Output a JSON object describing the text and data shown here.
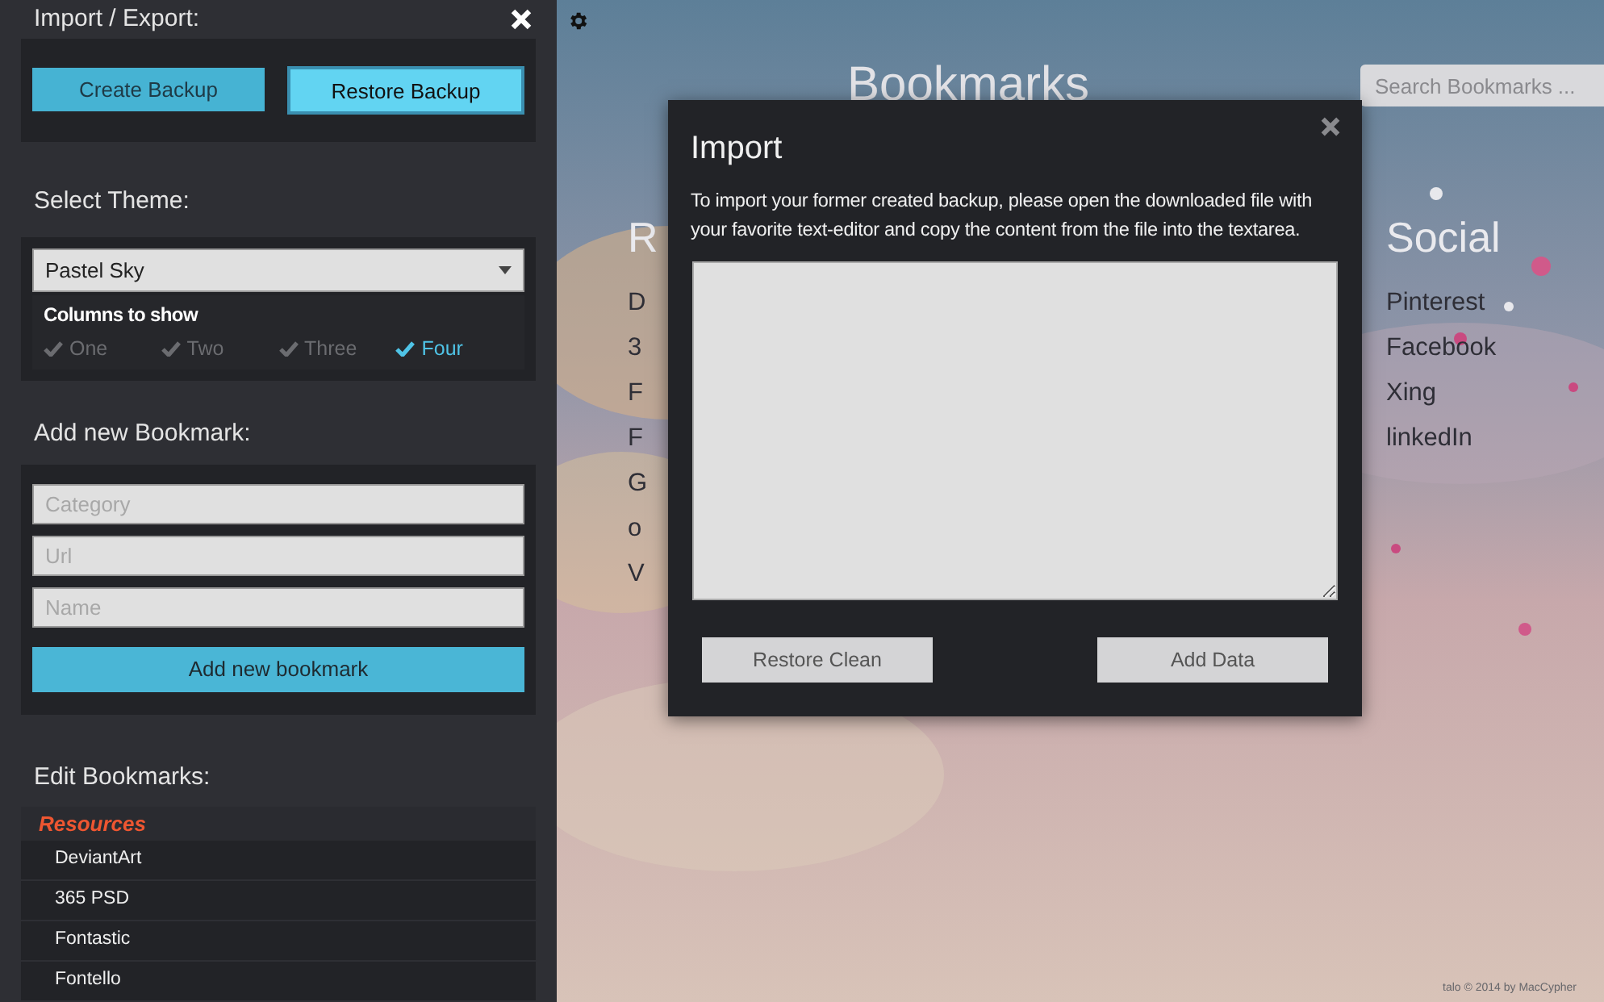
{
  "sidebar": {
    "import_export": {
      "title": "Import / Export:",
      "buttons": [
        {
          "label": "Create Backup",
          "selected": false
        },
        {
          "label": "Restore Backup",
          "selected": true
        }
      ]
    },
    "theme": {
      "title": "Select Theme:",
      "value": "Pastel Sky",
      "columns_label": "Columns to show",
      "columns": [
        {
          "label": "One",
          "selected": false
        },
        {
          "label": "Two",
          "selected": false
        },
        {
          "label": "Three",
          "selected": false
        },
        {
          "label": "Four",
          "selected": true
        }
      ]
    },
    "add_bookmark": {
      "title": "Add new Bookmark:",
      "fields": [
        {
          "placeholder": "Category"
        },
        {
          "placeholder": "Url"
        },
        {
          "placeholder": "Name"
        }
      ],
      "button": "Add new bookmark"
    },
    "edit_bookmarks": {
      "title": "Edit Bookmarks:",
      "category": "Resources",
      "items": [
        "DeviantArt",
        "365 PSD",
        "Fontastic",
        "Fontello"
      ]
    }
  },
  "main": {
    "title": "Bookmarks",
    "search": {
      "placeholder": "Search Bookmarks ..."
    },
    "columns": [
      {
        "heading": "R",
        "items": [
          "D",
          "3",
          "F",
          "F",
          "G",
          "o",
          "V"
        ]
      },
      {
        "heading": "Social",
        "items": [
          "Pinterest",
          "Facebook",
          "Xing",
          "linkedIn"
        ]
      }
    ],
    "footer": "talo © 2014 by MacCypher"
  },
  "dialog": {
    "title": "Import",
    "text": "To import your former created backup, please open the downloaded file with your favorite text-editor and copy the content from the file into the textarea.",
    "buttons": [
      "Restore Clean",
      "Add Data"
    ]
  }
}
